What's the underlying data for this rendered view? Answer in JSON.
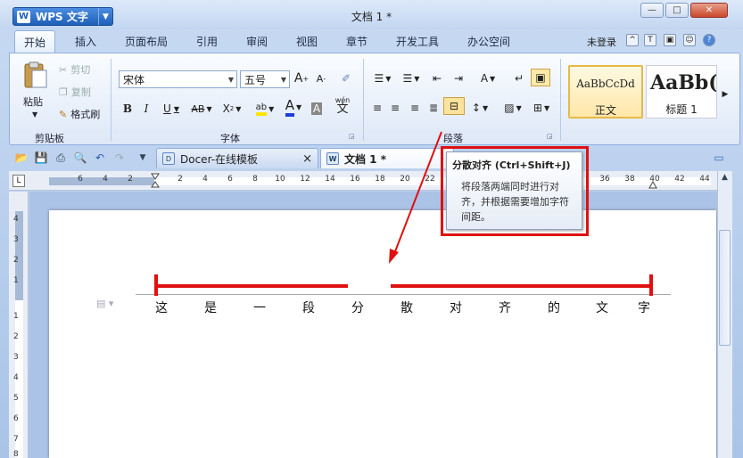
{
  "app": {
    "name": "WPS 文字",
    "logo": "W",
    "menu_arrow": "▼",
    "title": "文档 1 *",
    "window_controls": {
      "minimize": "—",
      "restore": "□",
      "close": "✕"
    }
  },
  "menu_tabs": [
    "开始",
    "插入",
    "页面布局",
    "引用",
    "审阅",
    "视图",
    "章节",
    "开发工具",
    "办公空间"
  ],
  "top_right": {
    "login": "未登录",
    "icons": [
      "collapse-ribbon-icon",
      "skin-icon",
      "feedback-icon",
      "share-icon",
      "help-icon"
    ],
    "glyphs": [
      "^",
      "T",
      "▣",
      "☺",
      "?"
    ]
  },
  "ribbon": {
    "clipboard": {
      "paste": "粘贴",
      "cut": "剪切",
      "copy": "复制",
      "format_painter": "格式刷",
      "group_label": "剪贴板"
    },
    "font": {
      "font_name": "宋体",
      "font_size": "五号",
      "grow": "A",
      "shrink": "A",
      "bold": "B",
      "italic": "I",
      "underline": "U",
      "strikethrough": "AB",
      "superscript": "X",
      "highlight": "ab",
      "color": "A",
      "shade": "A",
      "phonetic": "wén",
      "phonetic_char": "文",
      "group_label": "字体"
    },
    "paragraph": {
      "group_label": "段落"
    },
    "styles": {
      "normal_sample": "AaBbCcDd",
      "normal_name": "正文",
      "heading1_sample": "AaBb(",
      "heading1_name": "标题 1"
    }
  },
  "doc_tabs": [
    {
      "label": "Docer-在线模板",
      "close": "×"
    },
    {
      "label": "文档 1 *"
    }
  ],
  "ruler": {
    "ticks": [
      "6",
      "4",
      "2",
      "2",
      "4",
      "6",
      "8",
      "10",
      "12",
      "14",
      "16",
      "18",
      "20",
      "22",
      "36",
      "38",
      "40",
      "42",
      "44"
    ]
  },
  "vruler": {
    "ticks": [
      "4",
      "3",
      "2",
      "1",
      "1",
      "2",
      "3",
      "4",
      "5",
      "6",
      "7",
      "8"
    ]
  },
  "tooltip": {
    "title": "分散对齐 (Ctrl+Shift+J)",
    "description": "将段落两端同时进行对齐，并根据需要增加字符间距。"
  },
  "document": {
    "characters": [
      "这",
      "是",
      "一",
      "段",
      "分",
      "散",
      "对",
      "齐",
      "的",
      "文",
      "字"
    ]
  },
  "colors": {
    "annotation": "#e01010",
    "accent": "#1f5fb8"
  }
}
